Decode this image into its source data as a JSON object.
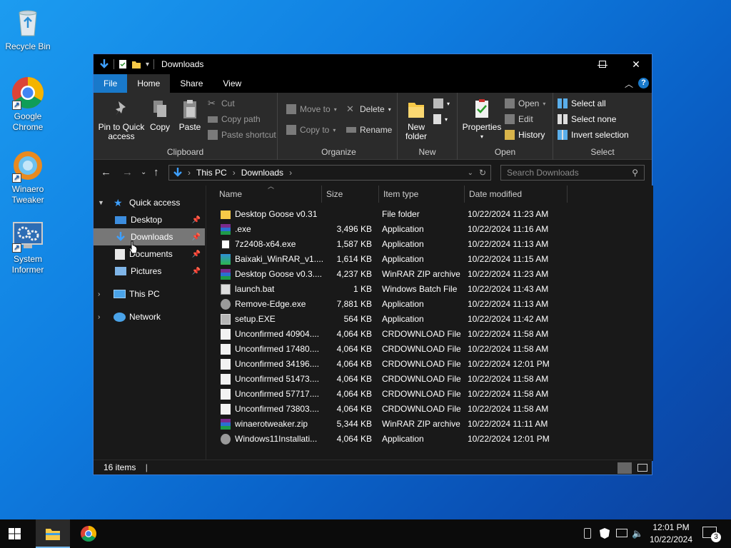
{
  "desktop": {
    "icons": [
      {
        "label1": "Recycle Bin",
        "label2": ""
      },
      {
        "label1": "Google",
        "label2": "Chrome"
      },
      {
        "label1": "Winaero",
        "label2": "Tweaker"
      },
      {
        "label1": "System",
        "label2": "Informer"
      }
    ]
  },
  "window": {
    "title": "Downloads"
  },
  "menu": {
    "tabs": [
      "File",
      "Home",
      "Share",
      "View"
    ]
  },
  "ribbon": {
    "clipboard": {
      "label": "Clipboard",
      "pin_line1": "Pin to Quick",
      "pin_line2": "access",
      "copy": "Copy",
      "paste": "Paste",
      "cut": "Cut",
      "copy_path": "Copy path",
      "paste_shortcut": "Paste shortcut"
    },
    "organize": {
      "label": "Organize",
      "move_to": "Move to",
      "copy_to": "Copy to",
      "delete": "Delete",
      "rename": "Rename"
    },
    "new": {
      "label": "New",
      "new_folder_line1": "New",
      "new_folder_line2": "folder"
    },
    "open": {
      "label": "Open",
      "properties": "Properties",
      "open": "Open",
      "edit": "Edit",
      "history": "History"
    },
    "select": {
      "label": "Select",
      "select_all": "Select all",
      "select_none": "Select none",
      "invert": "Invert selection"
    }
  },
  "address": {
    "crumbs": [
      "This PC",
      "Downloads"
    ],
    "search_placeholder": "Search Downloads"
  },
  "nav": {
    "quick_access": "Quick access",
    "items": [
      "Desktop",
      "Downloads",
      "Documents",
      "Pictures"
    ],
    "this_pc": "This PC",
    "network": "Network"
  },
  "columns": [
    "Name",
    "Size",
    "Item type",
    "Date modified"
  ],
  "files": [
    {
      "name": "Desktop Goose v0.31",
      "size": "",
      "type": "File folder",
      "date": "10/22/2024 11:23 AM",
      "icon": "folder-icon"
    },
    {
      "name": ".exe",
      "size": "3,496 KB",
      "type": "Application",
      "date": "10/22/2024 11:16 AM",
      "icon": "winrar-sfx-icon"
    },
    {
      "name": "7z2408-x64.exe",
      "size": "1,587 KB",
      "type": "Application",
      "date": "10/22/2024 11:13 AM",
      "icon": "7zip-icon"
    },
    {
      "name": "Baixaki_WinRAR_v1....",
      "size": "1,614 KB",
      "type": "Application",
      "date": "10/22/2024 11:15 AM",
      "icon": "installer-icon"
    },
    {
      "name": "Desktop Goose v0.3....",
      "size": "4,237 KB",
      "type": "WinRAR ZIP archive",
      "date": "10/22/2024 11:23 AM",
      "icon": "winrar-icon"
    },
    {
      "name": "launch.bat",
      "size": "1 KB",
      "type": "Windows Batch File",
      "date": "10/22/2024 11:43 AM",
      "icon": "batch-file-icon"
    },
    {
      "name": "Remove-Edge.exe",
      "size": "7,881 KB",
      "type": "Application",
      "date": "10/22/2024 11:13 AM",
      "icon": "app-icon"
    },
    {
      "name": "setup.EXE",
      "size": "564 KB",
      "type": "Application",
      "date": "10/22/2024 11:42 AM",
      "icon": "setup-icon"
    },
    {
      "name": "Unconfirmed 40904....",
      "size": "4,064 KB",
      "type": "CRDOWNLOAD File",
      "date": "10/22/2024 11:58 AM",
      "icon": "blank-file-icon"
    },
    {
      "name": "Unconfirmed 17480....",
      "size": "4,064 KB",
      "type": "CRDOWNLOAD File",
      "date": "10/22/2024 11:58 AM",
      "icon": "blank-file-icon"
    },
    {
      "name": "Unconfirmed 34196....",
      "size": "4,064 KB",
      "type": "CRDOWNLOAD File",
      "date": "10/22/2024 12:01 PM",
      "icon": "blank-file-icon"
    },
    {
      "name": "Unconfirmed 51473....",
      "size": "4,064 KB",
      "type": "CRDOWNLOAD File",
      "date": "10/22/2024 11:58 AM",
      "icon": "blank-file-icon"
    },
    {
      "name": "Unconfirmed 57717....",
      "size": "4,064 KB",
      "type": "CRDOWNLOAD File",
      "date": "10/22/2024 11:58 AM",
      "icon": "blank-file-icon"
    },
    {
      "name": "Unconfirmed 73803....",
      "size": "4,064 KB",
      "type": "CRDOWNLOAD File",
      "date": "10/22/2024 11:58 AM",
      "icon": "blank-file-icon"
    },
    {
      "name": "winaerotweaker.zip",
      "size": "5,344 KB",
      "type": "WinRAR ZIP archive",
      "date": "10/22/2024 11:11 AM",
      "icon": "winrar-icon"
    },
    {
      "name": "Windows11Installati...",
      "size": "4,064 KB",
      "type": "Application",
      "date": "10/22/2024 12:01 PM",
      "icon": "app-icon"
    }
  ],
  "status": {
    "items": "16 items"
  },
  "taskbar": {
    "time": "12:01 PM",
    "date": "10/22/2024",
    "notifications": "3"
  }
}
